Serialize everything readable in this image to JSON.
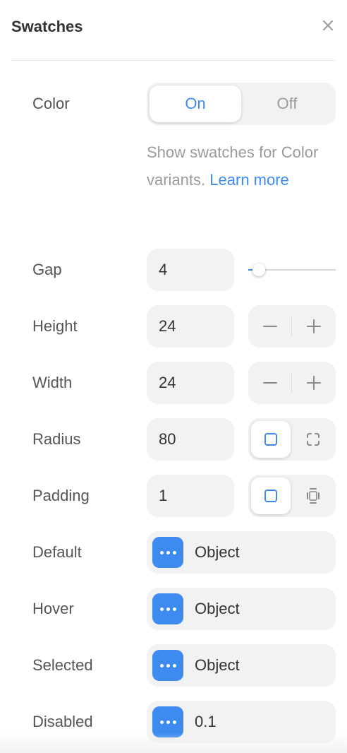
{
  "header": {
    "title": "Swatches",
    "close_icon": "close-icon"
  },
  "color": {
    "label": "Color",
    "options": [
      "On",
      "Off"
    ],
    "selected": "On",
    "description": "Show swatches for Color variants.",
    "link": "Learn more"
  },
  "gap": {
    "label": "Gap",
    "value": "4",
    "slider_fraction": 0.12
  },
  "height": {
    "label": "Height",
    "value": "24"
  },
  "width": {
    "label": "Width",
    "value": "24"
  },
  "radius": {
    "label": "Radius",
    "value": "80",
    "icons": [
      "square-icon",
      "corners-icon"
    ]
  },
  "padding": {
    "label": "Padding",
    "value": "1",
    "icons": [
      "square-icon",
      "padding-sides-icon"
    ]
  },
  "default": {
    "label": "Default",
    "value": "Object"
  },
  "hover": {
    "label": "Hover",
    "value": "Object"
  },
  "selected_state": {
    "label": "Selected",
    "value": "Object"
  },
  "disabled": {
    "label": "Disabled",
    "value": "0.1"
  },
  "colors": {
    "accent": "#3d8bef",
    "field_bg": "#f2f2f2",
    "label": "#555555",
    "muted": "#9b9b9b"
  }
}
